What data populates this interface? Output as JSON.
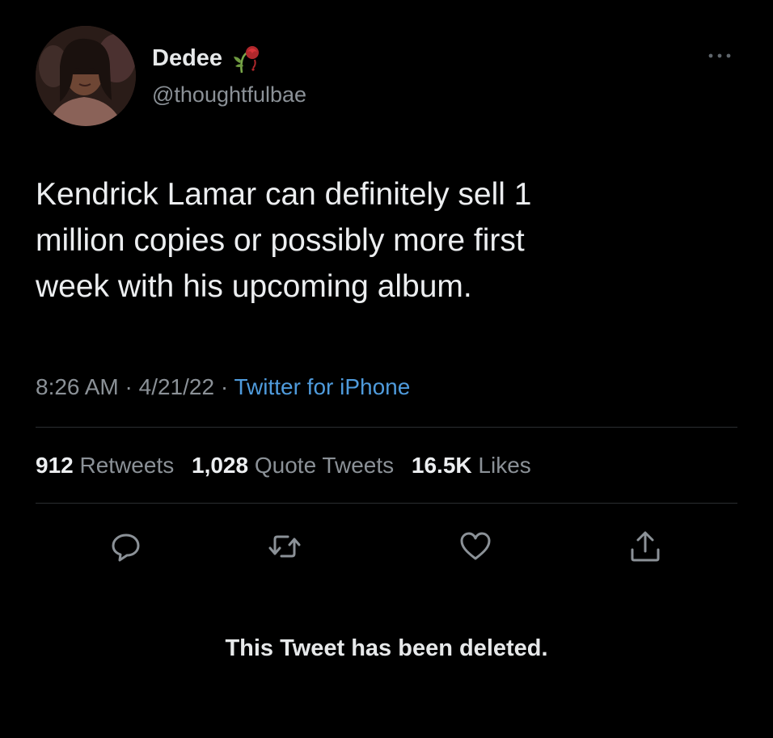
{
  "author": {
    "name": "Dedee",
    "handle": "@thoughtfulbae",
    "name_emoji_icon": "wilted-rose-icon",
    "avatar_icon": "profile-photo-avatar"
  },
  "tweet": {
    "text": "Kendrick Lamar can definitely sell 1\nmillion copies or possibly more first\nweek with his upcoming album.",
    "time": "8:26 AM",
    "date": "4/21/22",
    "separator": "·",
    "source": "Twitter for iPhone"
  },
  "stats": {
    "retweets_count": "912",
    "retweets_label": "Retweets",
    "quotes_count": "1,028",
    "quotes_label": "Quote Tweets",
    "likes_count": "16.5K",
    "likes_label": "Likes"
  },
  "actions": {
    "reply_icon": "reply-icon",
    "retweet_icon": "retweet-icon",
    "like_icon": "heart-icon",
    "share_icon": "share-icon",
    "more_icon": "more-dots-icon"
  },
  "deleted_notice": "This Tweet has been deleted.",
  "colors": {
    "background": "#000000",
    "text_primary": "#e7e9ea",
    "text_secondary": "#8b9197",
    "link": "#4f9bdc",
    "divider": "#2b2e31"
  }
}
